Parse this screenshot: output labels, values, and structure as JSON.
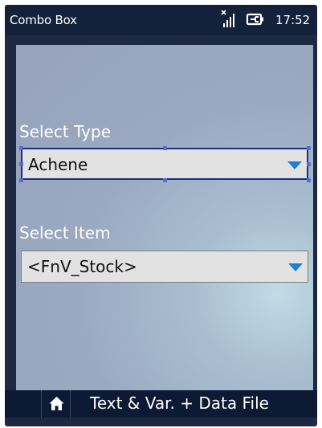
{
  "status_bar": {
    "title": "Combo Box",
    "time": "17:52"
  },
  "form": {
    "type_label": "Select Type",
    "type_value": "Achene",
    "item_label": "Select Item",
    "item_value": "<FnV_Stock>"
  },
  "bottom_bar": {
    "caption": "Text & Var. + Data File"
  },
  "colors": {
    "accent": "#1e7fd6",
    "selection_border": "#1c2f7a"
  }
}
